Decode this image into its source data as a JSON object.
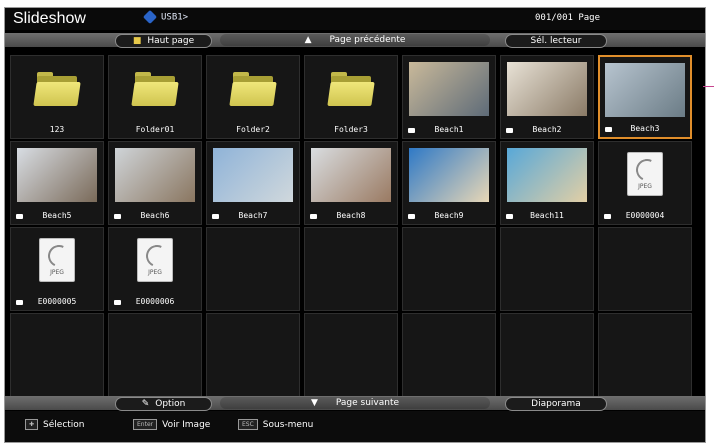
{
  "header": {
    "title": "Slideshow",
    "device": "USB1>",
    "page_indicator": "001/001 Page"
  },
  "top_bar": {
    "home": "Haut page",
    "prev": "Page précédente",
    "select_reader": "Sél. lecteur"
  },
  "bottom_bar": {
    "option": "Option",
    "next": "Page suivante",
    "slideshow": "Diaporama"
  },
  "footer": {
    "select": "Sélection",
    "enter_key": "Enter",
    "view": "Voir Image",
    "esc_key": "ESC",
    "submenu": "Sous-menu"
  },
  "files": [
    {
      "label": "123",
      "type": "folder"
    },
    {
      "label": "Folder01",
      "type": "folder"
    },
    {
      "label": "Folder2",
      "type": "folder"
    },
    {
      "label": "Folder3",
      "type": "folder"
    },
    {
      "label": "Beach1",
      "type": "photo",
      "c1": "#c9b99a",
      "c2": "#5e6b78",
      "selected": false
    },
    {
      "label": "Beach2",
      "type": "photo",
      "c1": "#e8e2d6",
      "c2": "#8a7a66",
      "selected": false
    },
    {
      "label": "Beach3",
      "type": "photo",
      "c1": "#b7c4cf",
      "c2": "#6b7c86",
      "selected": true
    },
    {
      "label": "Beach5",
      "type": "photo",
      "c1": "#d8dde3",
      "c2": "#7a6a59"
    },
    {
      "label": "Beach6",
      "type": "photo",
      "c1": "#cfd4d8",
      "c2": "#8a7660"
    },
    {
      "label": "Beach7",
      "type": "photo",
      "c1": "#8fb3d8",
      "c2": "#d0d8dc"
    },
    {
      "label": "Beach8",
      "type": "photo",
      "c1": "#d9dde0",
      "c2": "#9a7a62"
    },
    {
      "label": "Beach9",
      "type": "photo",
      "c1": "#2f79c6",
      "c2": "#e8d7b6"
    },
    {
      "label": "Beach11",
      "type": "photo",
      "c1": "#58a8d8",
      "c2": "#e2cfa5"
    },
    {
      "label": "E0000004",
      "type": "jpeg"
    },
    {
      "label": "E0000005",
      "type": "jpeg"
    },
    {
      "label": "E0000006",
      "type": "jpeg"
    }
  ],
  "colors": {
    "selection": "#e08e2b",
    "folder": "#e2d860"
  }
}
